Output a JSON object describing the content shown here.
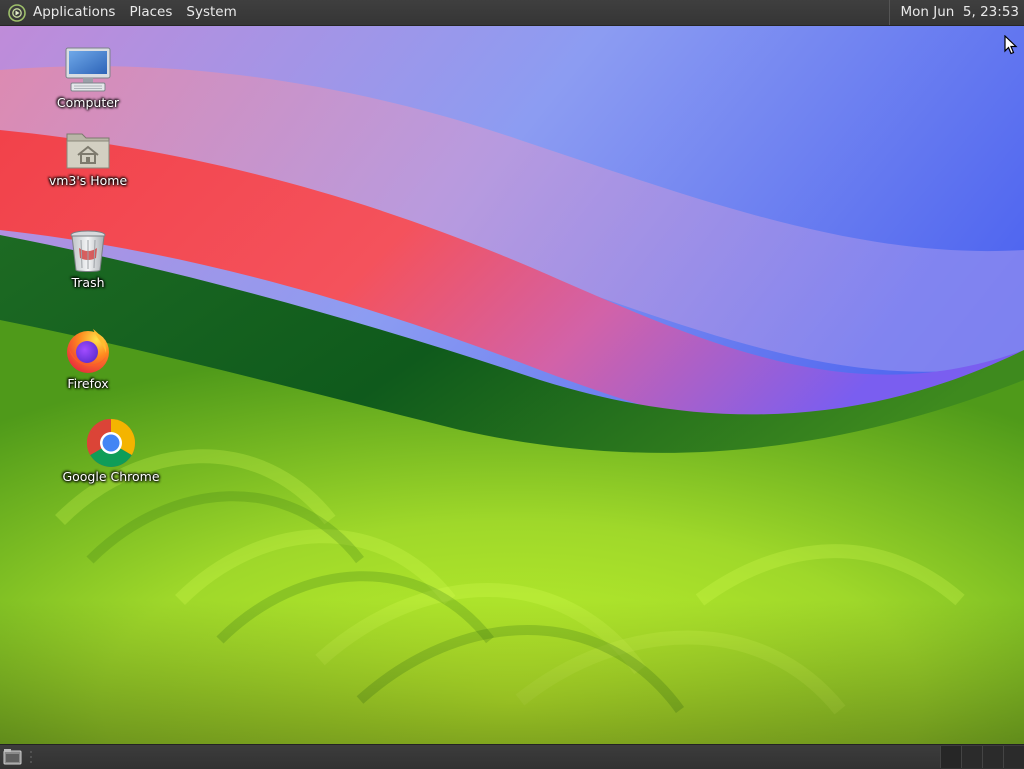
{
  "top_panel": {
    "menus": [
      {
        "label": "Applications"
      },
      {
        "label": "Places"
      },
      {
        "label": "System"
      }
    ],
    "clock": "Mon Jun  5, 23:53",
    "logo_icon": "distro-logo-icon"
  },
  "desktop": {
    "icons": [
      {
        "label": "Computer",
        "icon": "computer-icon"
      },
      {
        "label": "vm3's Home",
        "icon": "home-folder-icon"
      },
      {
        "label": "Trash",
        "icon": "trash-icon"
      },
      {
        "label": "Firefox",
        "icon": "firefox-icon"
      },
      {
        "label": "Google Chrome",
        "icon": "chrome-icon"
      }
    ]
  },
  "bottom_panel": {
    "show_desktop_icon": "show-desktop-icon",
    "workspaces": 4
  },
  "colors": {
    "panel_bg": "#3a3a3a",
    "panel_text": "#e9e9e9",
    "wallpaper_green": "#a6df28",
    "wallpaper_red": "#f0474f",
    "wallpaper_blue": "#4a5cf0"
  }
}
